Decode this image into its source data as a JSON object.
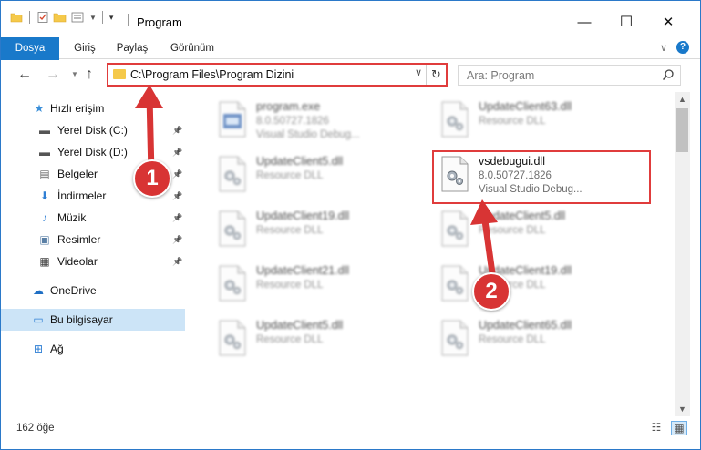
{
  "window": {
    "title": "Program",
    "controls": {
      "minimize": "—",
      "maximize": "☐",
      "close": "✕"
    }
  },
  "ribbon": {
    "tabs": [
      "Dosya",
      "Giriş",
      "Paylaş",
      "Görünüm"
    ],
    "chevron": "∨",
    "help": "?"
  },
  "address": {
    "path": "C:\\Program Files\\Program Dizini",
    "search_placeholder": "Ara: Program"
  },
  "nav": {
    "items": [
      {
        "label": "Hızlı erişim",
        "icon": "star-icon",
        "glyph": "★",
        "color": "#3b8fd9",
        "pinned": false
      },
      {
        "label": "Yerel Disk (C:)",
        "icon": "drive-icon",
        "glyph": "▬",
        "color": "#555555",
        "pinned": true
      },
      {
        "label": "Yerel Disk (D:)",
        "icon": "drive-icon",
        "glyph": "▬",
        "color": "#555555",
        "pinned": true
      },
      {
        "label": "Belgeler",
        "icon": "documents-icon",
        "glyph": "▤",
        "color": "#6a6a6a",
        "pinned": true
      },
      {
        "label": "İndirmeler",
        "icon": "download-icon",
        "glyph": "⬇",
        "color": "#2f7fd4",
        "pinned": true
      },
      {
        "label": "Müzik",
        "icon": "music-icon",
        "glyph": "♪",
        "color": "#2f7fd4",
        "pinned": true
      },
      {
        "label": "Resimler",
        "icon": "pictures-icon",
        "glyph": "▣",
        "color": "#5a7fa5",
        "pinned": true
      },
      {
        "label": "Videolar",
        "icon": "video-icon",
        "glyph": "▦",
        "color": "#444444",
        "pinned": true
      },
      {
        "label": "OneDrive",
        "icon": "cloud-icon",
        "glyph": "☁",
        "color": "#1f6fc4",
        "pinned": false
      },
      {
        "label": "Bu bilgisayar",
        "icon": "computer-icon",
        "glyph": "▭",
        "color": "#2f7fd4",
        "pinned": false
      },
      {
        "label": "Ağ",
        "icon": "network-icon",
        "glyph": "⊞",
        "color": "#2f7fd4",
        "pinned": false
      }
    ]
  },
  "files": [
    {
      "name": "program.exe",
      "line2": "8.0.50727.1826",
      "line3": "Visual Studio Debug...",
      "blurred": true
    },
    {
      "name": "UpdateClient63.dll",
      "line2": "Resource DLL",
      "line3": "",
      "blurred": true
    },
    {
      "name": "UpdateClient5.dll",
      "line2": "Resource DLL",
      "line3": "",
      "blurred": true
    },
    {
      "name": "vsdebugui.dll",
      "line2": "8.0.50727.1826",
      "line3": "Visual Studio Debug...",
      "blurred": false
    },
    {
      "name": "UpdateClient19.dll",
      "line2": "Resource DLL",
      "line3": "",
      "blurred": true
    },
    {
      "name": "UpdateClient5.dll",
      "line2": "Resource DLL",
      "line3": "",
      "blurred": true
    },
    {
      "name": "UpdateClient21.dll",
      "line2": "Resource DLL",
      "line3": "",
      "blurred": true
    },
    {
      "name": "UpdateClient19.dll",
      "line2": "Resource DLL",
      "line3": "",
      "blurred": true
    },
    {
      "name": "UpdateClient5.dll",
      "line2": "Resource DLL",
      "line3": "",
      "blurred": true
    },
    {
      "name": "UpdateClient65.dll",
      "line2": "Resource DLL",
      "line3": "",
      "blurred": true
    }
  ],
  "status": {
    "count": "162 öğe"
  },
  "annotations": {
    "badge1": "1",
    "badge2": "2",
    "color": "#d83434"
  }
}
